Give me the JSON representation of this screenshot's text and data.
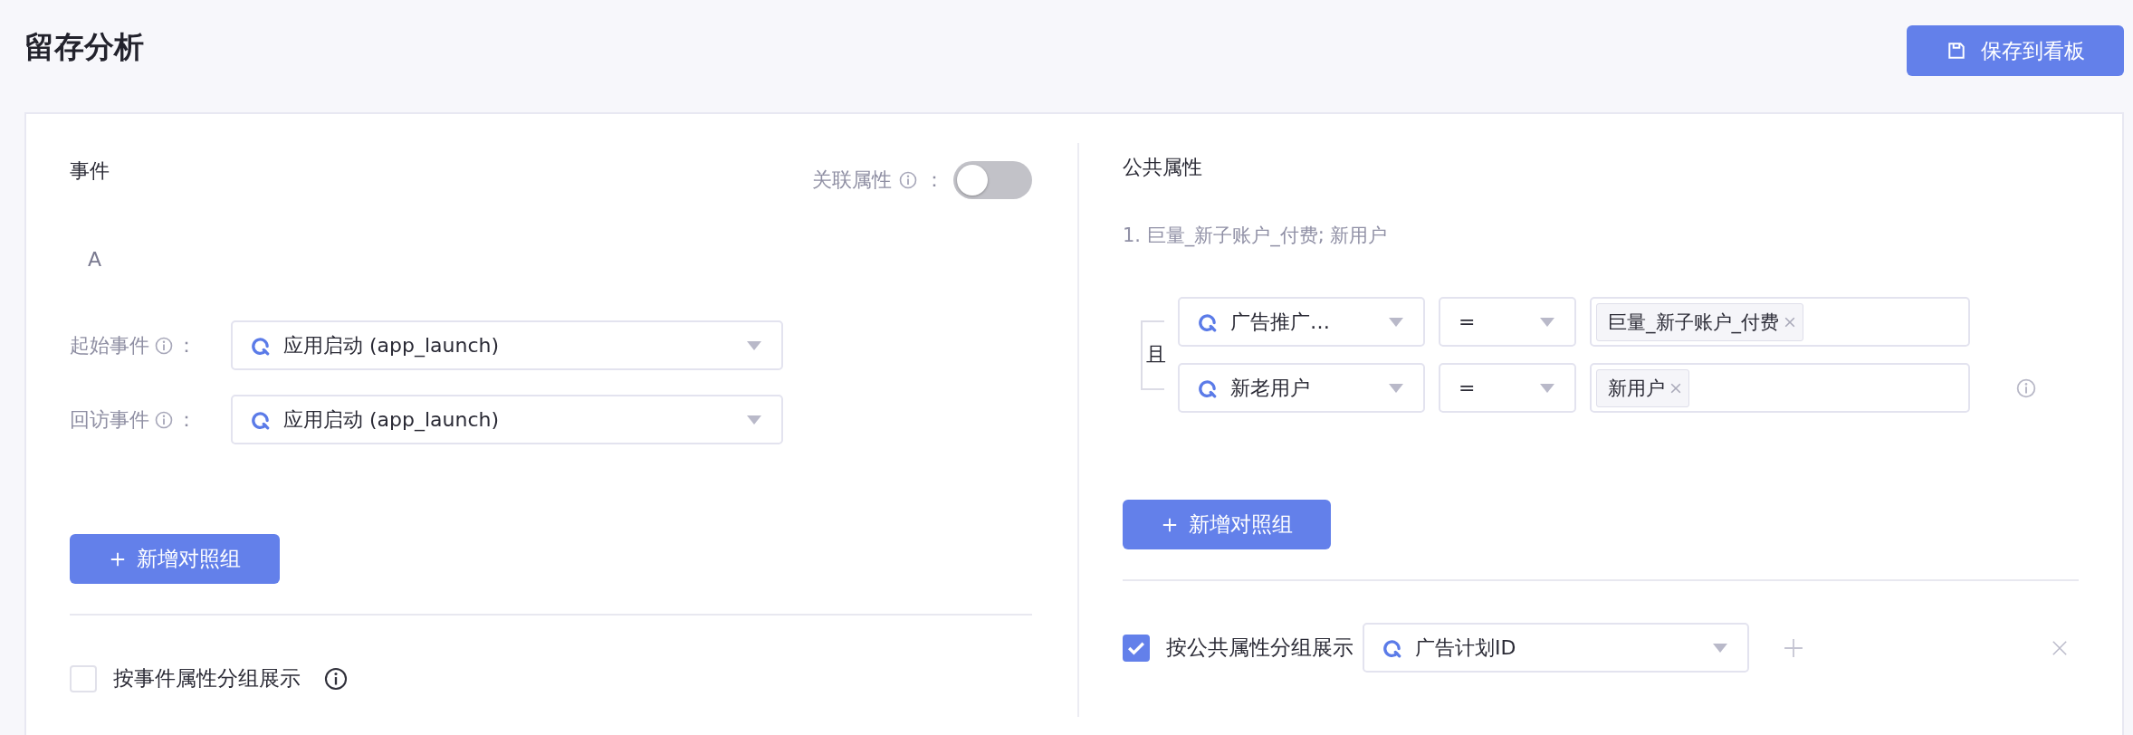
{
  "page_title": "留存分析",
  "save_button": {
    "label": "保存到看板"
  },
  "events": {
    "title": "事件",
    "link_toggle": {
      "label": "关联属性",
      "separator": "：",
      "on": false
    },
    "group_label": "A",
    "fields": [
      {
        "label": "起始事件",
        "separator": "：",
        "value": "应用启动 (app_launch)"
      },
      {
        "label": "回访事件",
        "separator": "：",
        "value": "应用启动 (app_launch)"
      }
    ],
    "add_button": {
      "label": "新增对照组"
    },
    "group_by": {
      "label": "按事件属性分组展示",
      "checked": false
    }
  },
  "common": {
    "title": "公共属性",
    "summary": "1. 巨量_新子账户_付费; 新用户",
    "conjunction": "且",
    "filters": [
      {
        "property": "广告推广…",
        "operator": "=",
        "tags": [
          "巨量_新子账户_付费"
        ]
      },
      {
        "property": "新老用户",
        "operator": "=",
        "tags": [
          "新用户"
        ]
      }
    ],
    "add_button": {
      "label": "新增对照组"
    },
    "group_by": {
      "label": "按公共属性分组展示",
      "checked": true,
      "property": "广告计划ID"
    }
  }
}
